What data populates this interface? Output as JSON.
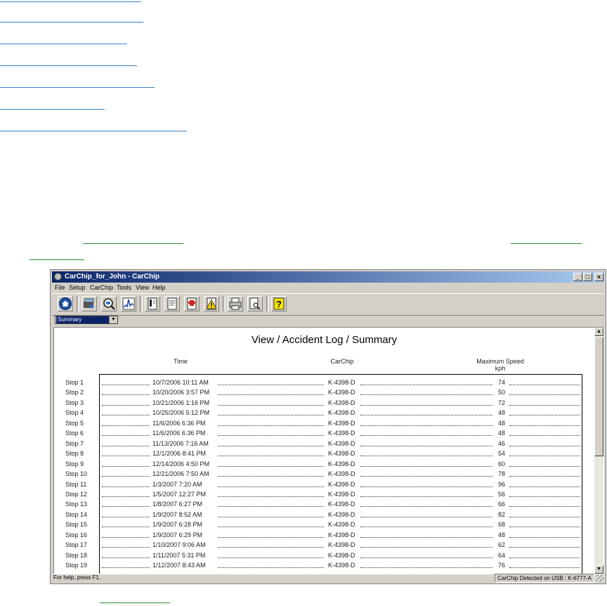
{
  "window": {
    "title": "CarChip_for_John - CarChip",
    "controls": {
      "minimize": "_",
      "maximize": "□",
      "close": "×"
    }
  },
  "menu": [
    "File",
    "Setup",
    "CarChip",
    "Tools",
    "View",
    "Help"
  ],
  "toolbar": {
    "icons": [
      "home-icon",
      "download-icon",
      "zoom-icon",
      "graph-icon",
      "report-icon",
      "document-icon",
      "alert-document-icon",
      "warning-icon",
      "print-icon",
      "print-preview-icon",
      "help-icon"
    ]
  },
  "view_select": {
    "value": "Summary",
    "arrow": "▼"
  },
  "report": {
    "title": "View / Accident Log / Summary",
    "columns": {
      "time": "Time",
      "carchip": "CarChip",
      "speed": "Maximum Speed",
      "speed_unit": "kph"
    },
    "rows": [
      {
        "label": "Stop 1",
        "time": "10/7/2006 10:11 AM",
        "carchip": "K-4398-D",
        "speed": "74"
      },
      {
        "label": "Stop 2",
        "time": "10/20/2006 3:57 PM",
        "carchip": "K-4398-D",
        "speed": "50"
      },
      {
        "label": "Stop 3",
        "time": "10/21/2006 1:16 PM",
        "carchip": "K-4398-D",
        "speed": "72"
      },
      {
        "label": "Stop 4",
        "time": "10/25/2006 5:12 PM",
        "carchip": "K-4398-D",
        "speed": "48"
      },
      {
        "label": "Stop 5",
        "time": "11/6/2006 6:36 PM",
        "carchip": "K-4398-D",
        "speed": "48"
      },
      {
        "label": "Stop 6",
        "time": "11/6/2006 6:36 PM",
        "carchip": "K-4398-D",
        "speed": "48"
      },
      {
        "label": "Stop 7",
        "time": "11/13/2006 7:16 AM",
        "carchip": "K-4398-D",
        "speed": "46"
      },
      {
        "label": "Stop 8",
        "time": "12/1/2006 8:41 PM",
        "carchip": "K-4398-D",
        "speed": "54"
      },
      {
        "label": "Stop 9",
        "time": "12/14/2006 4:50 PM",
        "carchip": "K-4398-D",
        "speed": "60"
      },
      {
        "label": "Stop 10",
        "time": "12/21/2006 7:50 AM",
        "carchip": "K-4398-D",
        "speed": "78"
      },
      {
        "label": "Stop 11",
        "time": "1/3/2007 7:20 AM",
        "carchip": "K-4398-D",
        "speed": "96"
      },
      {
        "label": "Stop 12",
        "time": "1/5/2007 12:27 PM",
        "carchip": "K-4398-D",
        "speed": "56"
      },
      {
        "label": "Stop 13",
        "time": "1/8/2007 6:27 PM",
        "carchip": "K-4398-D",
        "speed": "66"
      },
      {
        "label": "Stop 14",
        "time": "1/9/2007 8:52 AM",
        "carchip": "K-4398-D",
        "speed": "82"
      },
      {
        "label": "Stop 15",
        "time": "1/9/2007 6:28 PM",
        "carchip": "K-4398-D",
        "speed": "68"
      },
      {
        "label": "Stop 16",
        "time": "1/9/2007 6:29 PM",
        "carchip": "K-4398-D",
        "speed": "48"
      },
      {
        "label": "Stop 17",
        "time": "1/10/2007 9:06 AM",
        "carchip": "K-4398-D",
        "speed": "62"
      },
      {
        "label": "Stop 18",
        "time": "1/11/2007 5:31 PM",
        "carchip": "K-4398-D",
        "speed": "64"
      },
      {
        "label": "Stop 19",
        "time": "1/12/2007 8:43 AM",
        "carchip": "K-4398-D",
        "speed": "76"
      }
    ]
  },
  "scroll": {
    "up": "▲",
    "down": "▼"
  },
  "status": {
    "help": "For help, press F1.",
    "detected": "CarChip Detected on USB : K-6777-A"
  }
}
